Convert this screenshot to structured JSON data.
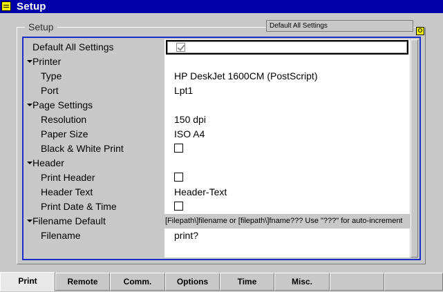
{
  "window": {
    "title": "Setup"
  },
  "group": {
    "label": "Setup",
    "header_field": "Default All Settings"
  },
  "rows": [
    {
      "label": "Default All Settings",
      "level": 0,
      "type": "focus-checkbox",
      "checked": true
    },
    {
      "label": "Printer",
      "level": 0,
      "type": "section"
    },
    {
      "label": "Type",
      "level": 1,
      "type": "text",
      "value": "HP DeskJet 1600CM (PostScript)"
    },
    {
      "label": "Port",
      "level": 1,
      "type": "text",
      "value": "Lpt1"
    },
    {
      "label": "Page Settings",
      "level": 0,
      "type": "section"
    },
    {
      "label": "Resolution",
      "level": 1,
      "type": "text",
      "value": "150 dpi"
    },
    {
      "label": "Paper Size",
      "level": 1,
      "type": "text",
      "value": "ISO A4"
    },
    {
      "label": "Black & White Print",
      "level": 1,
      "type": "checkbox",
      "checked": false
    },
    {
      "label": "Header",
      "level": 0,
      "type": "section"
    },
    {
      "label": "Print Header",
      "level": 1,
      "type": "checkbox",
      "checked": false
    },
    {
      "label": "Header Text",
      "level": 1,
      "type": "text",
      "value": "Header-Text"
    },
    {
      "label": "Print Date & Time",
      "level": 1,
      "type": "checkbox",
      "checked": false
    },
    {
      "label": "Filename Default",
      "level": 0,
      "type": "section-hint",
      "hint": "[Filepath\\]filename or [filepath\\]fname??? Use \"???\" for auto-increment"
    },
    {
      "label": "Filename",
      "level": 1,
      "type": "text",
      "value": "print?"
    }
  ],
  "tabs": [
    {
      "label": "Print",
      "active": true
    },
    {
      "label": "Remote",
      "active": false
    },
    {
      "label": "Comm.",
      "active": false
    },
    {
      "label": "Options",
      "active": false
    },
    {
      "label": "Time",
      "active": false
    },
    {
      "label": "Misc.",
      "active": false
    },
    {
      "label": "",
      "active": false
    },
    {
      "label": "",
      "active": false
    }
  ],
  "colors": {
    "title_bar": "#0000a8",
    "focus_frame": "#1c2cc8",
    "background": "#c8c8c8",
    "icon_yellow": "#f0f000"
  },
  "icons": {
    "system_menu": "window-menu-icon",
    "help": "help-icon"
  }
}
